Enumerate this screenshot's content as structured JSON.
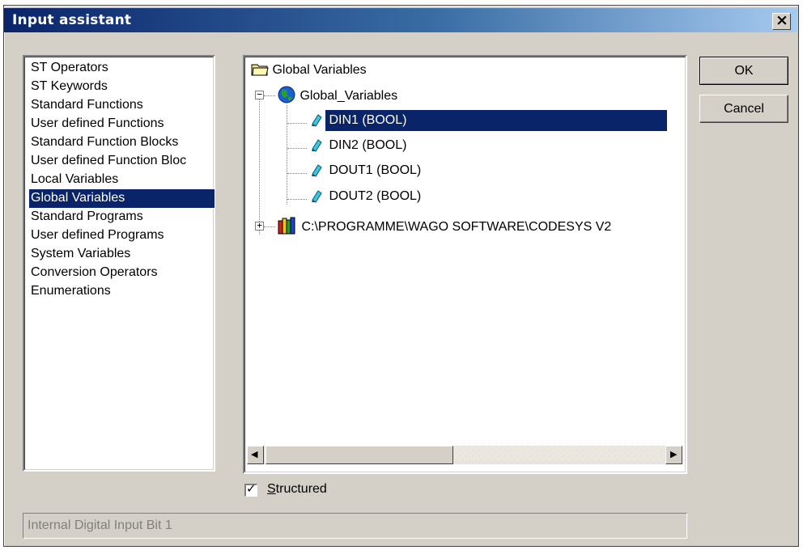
{
  "window": {
    "title": "Input assistant",
    "close_glyph": "×"
  },
  "categories": [
    {
      "label": "ST Operators",
      "selected": false
    },
    {
      "label": "ST Keywords",
      "selected": false
    },
    {
      "label": "Standard Functions",
      "selected": false
    },
    {
      "label": "User defined Functions",
      "selected": false
    },
    {
      "label": "Standard Function Blocks",
      "selected": false
    },
    {
      "label": "User defined Function Bloc",
      "selected": false
    },
    {
      "label": "Local Variables",
      "selected": false
    },
    {
      "label": "Global Variables",
      "selected": true
    },
    {
      "label": "Standard Programs",
      "selected": false
    },
    {
      "label": "User defined Programs",
      "selected": false
    },
    {
      "label": "System Variables",
      "selected": false
    },
    {
      "label": "Conversion Operators",
      "selected": false
    },
    {
      "label": "Enumerations",
      "selected": false
    }
  ],
  "tree": {
    "root": "Global Variables",
    "group": "Global_Variables",
    "variables": [
      "DIN1 (BOOL)",
      "DIN2 (BOOL)",
      "DOUT1 (BOOL)",
      "DOUT2 (BOOL)"
    ],
    "selected_variable": "DIN1 (BOOL)",
    "library": "C:\\PROGRAMME\\WAGO SOFTWARE\\CODESYS V2",
    "expand_minus": "−",
    "expand_plus": "+"
  },
  "scrollbar": {
    "left_arrow": "◀",
    "right_arrow": "▶"
  },
  "buttons": {
    "ok": "OK",
    "cancel": "Cancel"
  },
  "structured": {
    "label_first": "S",
    "label_rest": "tructured",
    "checked": true,
    "check_glyph": "✓"
  },
  "description": "Internal Digital Input Bit 1",
  "colors": {
    "selection": "#0a246a",
    "title_start": "#0a246a",
    "title_end": "#a6caf0",
    "face": "#d4d0c8"
  }
}
